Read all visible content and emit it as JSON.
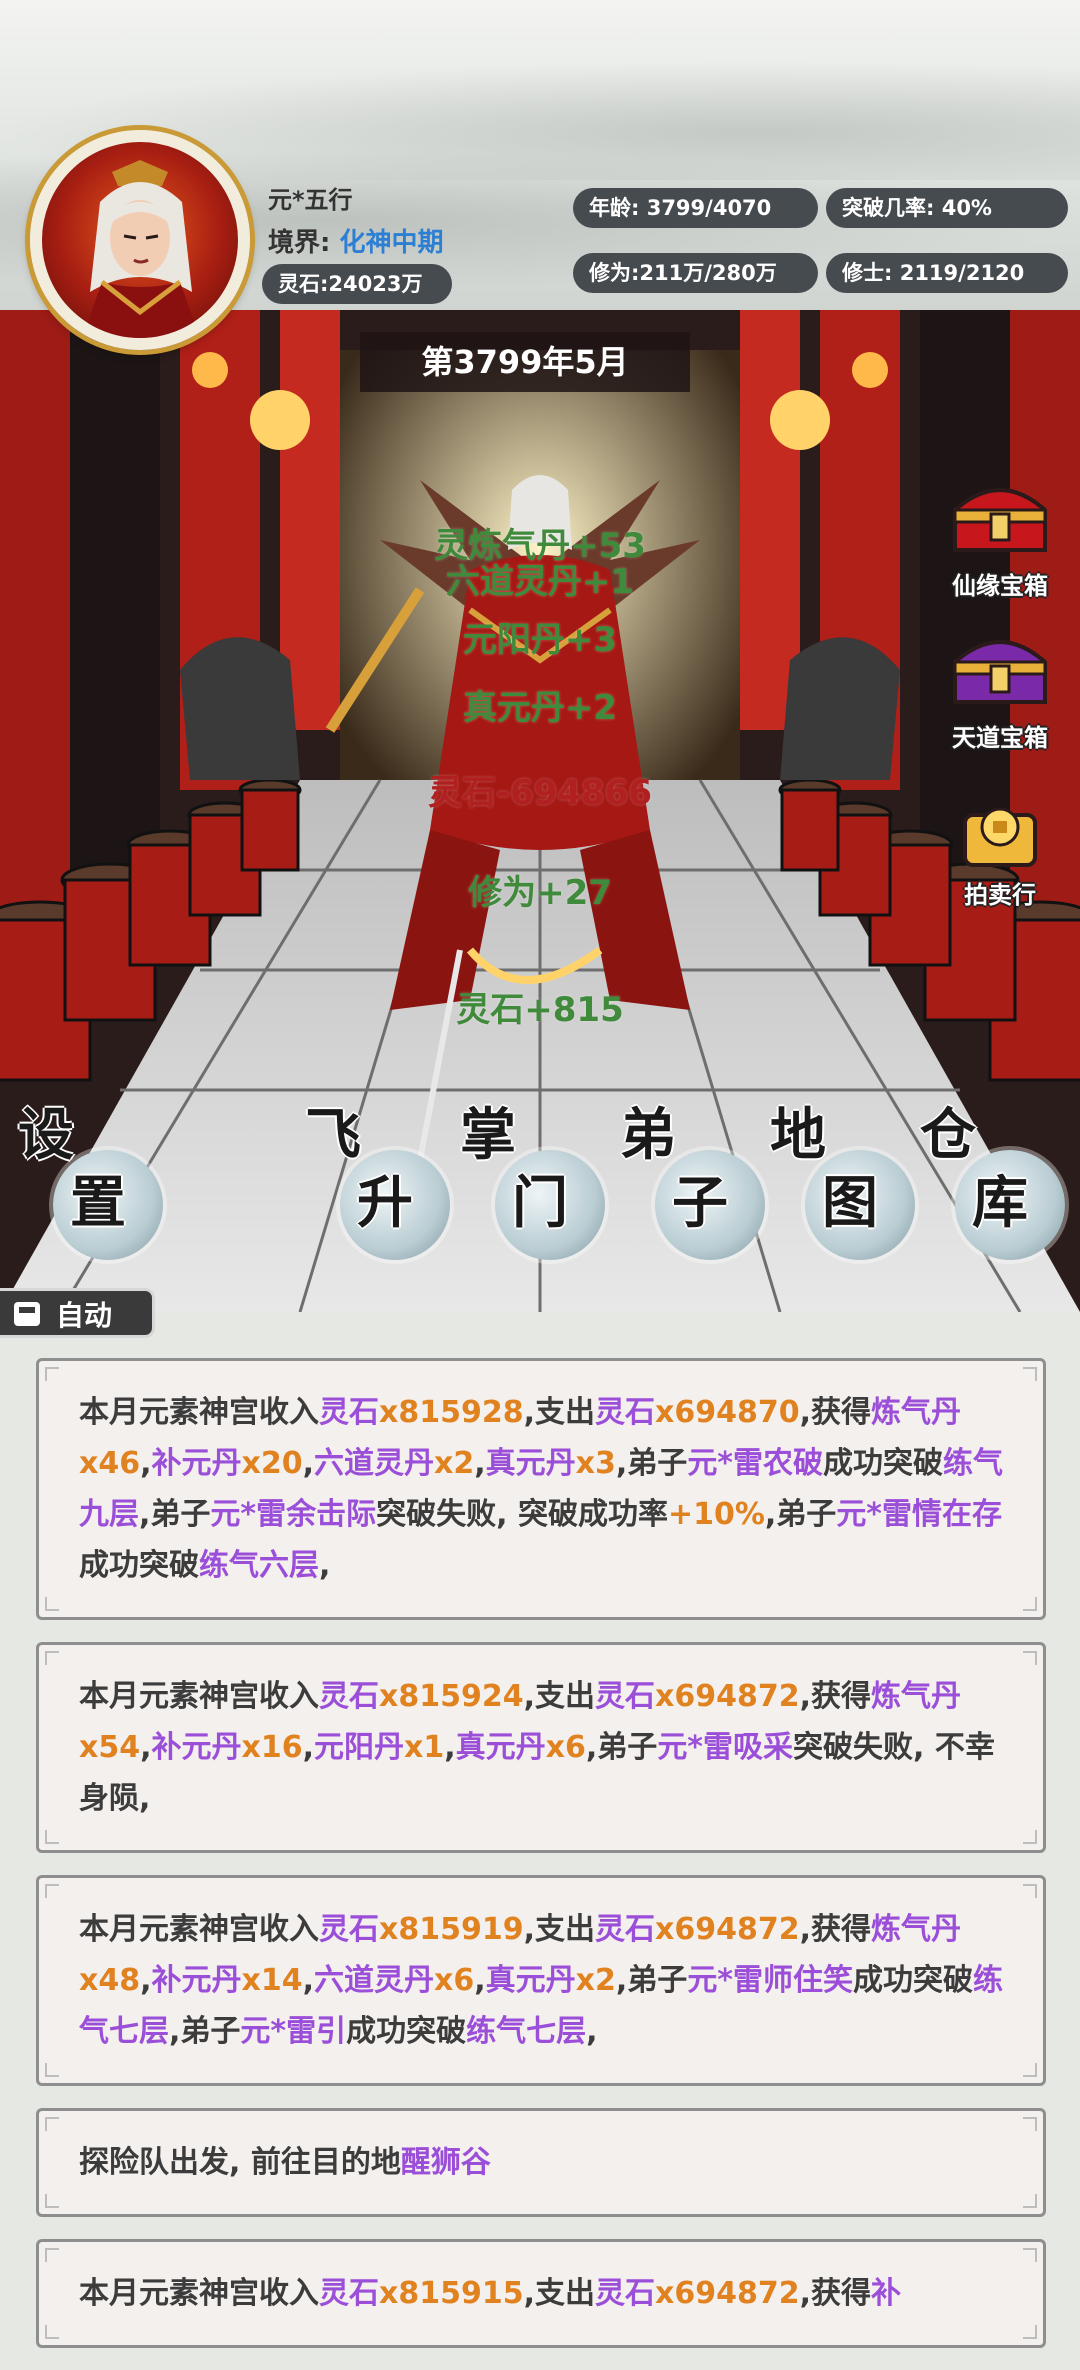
{
  "player": {
    "name": "元*五行",
    "realm_label": "境界:",
    "realm_value": "化神中期",
    "spirit_stone": "灵石:24023万"
  },
  "stats": {
    "age": "年龄: 3799/4070",
    "breakthrough": "突破几率:   40%",
    "cultivation": "修为:211万/280万",
    "disciples": "修士: 2119/2120"
  },
  "scene": {
    "date": "第3799年5月",
    "floating_texts": [
      {
        "text": "灵炼气丹+53",
        "color": "#3f8a3b"
      },
      {
        "text": "六道灵丹+1",
        "color": "#3f8a3b"
      },
      {
        "text": "元阳丹+3",
        "color": "#3f8a3b"
      },
      {
        "text": "真元丹+2",
        "color": "#3f8a3b"
      },
      {
        "text": "灵石-694866",
        "color": "#b02020"
      },
      {
        "text": "修为+27",
        "color": "#3f8a3b"
      },
      {
        "text": "灵石+815",
        "color": "#3f8a3b"
      }
    ]
  },
  "side_buttons": {
    "xianyuan": "仙缘宝箱",
    "tiandao": "天道宝箱",
    "auction": "拍卖行"
  },
  "nav": {
    "settings": [
      "设",
      "置"
    ],
    "ascend": [
      "飞",
      "升"
    ],
    "leader": [
      "掌",
      "门"
    ],
    "disciple": [
      "弟",
      "子"
    ],
    "map": [
      "地",
      "图"
    ],
    "storage": [
      "仓",
      "库"
    ]
  },
  "auto_label": "自动",
  "colors": {
    "purple_item": "#9b4fd9",
    "orange_value": "#e0821f",
    "header_pill": "#464b4f"
  },
  "log_entries": [
    [
      {
        "t": "本月元素神宫收入"
      },
      {
        "t": "灵石",
        "c": "p"
      },
      {
        "t": "x815928",
        "c": "o"
      },
      {
        "t": ",支出"
      },
      {
        "t": "灵石",
        "c": "p"
      },
      {
        "t": "x694870",
        "c": "o"
      },
      {
        "t": ",获得"
      },
      {
        "t": "炼气丹",
        "c": "p"
      },
      {
        "t": "x46",
        "c": "o"
      },
      {
        "t": ","
      },
      {
        "t": "补元丹",
        "c": "p"
      },
      {
        "t": "x20",
        "c": "o"
      },
      {
        "t": ","
      },
      {
        "t": "六道灵丹",
        "c": "p"
      },
      {
        "t": "x2",
        "c": "o"
      },
      {
        "t": ","
      },
      {
        "t": "真元丹",
        "c": "p"
      },
      {
        "t": "x3",
        "c": "o"
      },
      {
        "t": ",弟子"
      },
      {
        "t": "元*雷农破",
        "c": "p"
      },
      {
        "t": "成功突破"
      },
      {
        "t": "练气九层",
        "c": "p"
      },
      {
        "t": ",弟子"
      },
      {
        "t": "元*雷余击际",
        "c": "p"
      },
      {
        "t": "突破失败, 突破成功率"
      },
      {
        "t": "+10%",
        "c": "o"
      },
      {
        "t": ",弟子"
      },
      {
        "t": "元*雷情在存",
        "c": "p"
      },
      {
        "t": "成功突破"
      },
      {
        "t": "练气六层",
        "c": "p"
      },
      {
        "t": ","
      }
    ],
    [
      {
        "t": "本月元素神宫收入"
      },
      {
        "t": "灵石",
        "c": "p"
      },
      {
        "t": "x815924",
        "c": "o"
      },
      {
        "t": ",支出"
      },
      {
        "t": "灵石",
        "c": "p"
      },
      {
        "t": "x694872",
        "c": "o"
      },
      {
        "t": ",获得"
      },
      {
        "t": "炼气丹",
        "c": "p"
      },
      {
        "t": "x54",
        "c": "o"
      },
      {
        "t": ","
      },
      {
        "t": "补元丹",
        "c": "p"
      },
      {
        "t": "x16",
        "c": "o"
      },
      {
        "t": ","
      },
      {
        "t": "元阳丹",
        "c": "p"
      },
      {
        "t": "x1",
        "c": "o"
      },
      {
        "t": ","
      },
      {
        "t": "真元丹",
        "c": "p"
      },
      {
        "t": "x6",
        "c": "o"
      },
      {
        "t": ",弟子"
      },
      {
        "t": "元*雷吸采",
        "c": "p"
      },
      {
        "t": "突破失败, 不幸身陨,"
      }
    ],
    [
      {
        "t": "本月元素神宫收入"
      },
      {
        "t": "灵石",
        "c": "p"
      },
      {
        "t": "x815919",
        "c": "o"
      },
      {
        "t": ",支出"
      },
      {
        "t": "灵石",
        "c": "p"
      },
      {
        "t": "x694872",
        "c": "o"
      },
      {
        "t": ",获得"
      },
      {
        "t": "炼气丹",
        "c": "p"
      },
      {
        "t": "x48",
        "c": "o"
      },
      {
        "t": ","
      },
      {
        "t": "补元丹",
        "c": "p"
      },
      {
        "t": "x14",
        "c": "o"
      },
      {
        "t": ","
      },
      {
        "t": "六道灵丹",
        "c": "p"
      },
      {
        "t": "x6",
        "c": "o"
      },
      {
        "t": ","
      },
      {
        "t": "真元丹",
        "c": "p"
      },
      {
        "t": "x2",
        "c": "o"
      },
      {
        "t": ",弟子"
      },
      {
        "t": "元*雷师住笑",
        "c": "p"
      },
      {
        "t": "成功突破"
      },
      {
        "t": "练气七层",
        "c": "p"
      },
      {
        "t": ",弟子"
      },
      {
        "t": "元*雷引",
        "c": "p"
      },
      {
        "t": "成功突破"
      },
      {
        "t": "练气七层",
        "c": "p"
      },
      {
        "t": ","
      }
    ],
    [
      {
        "t": "探险队出发, 前往目的地"
      },
      {
        "t": "醒狮谷",
        "c": "p"
      }
    ],
    [
      {
        "t": "本月元素神宫收入"
      },
      {
        "t": "灵石",
        "c": "p"
      },
      {
        "t": "x815915",
        "c": "o"
      },
      {
        "t": ",支出"
      },
      {
        "t": "灵石",
        "c": "p"
      },
      {
        "t": "x694872",
        "c": "o"
      },
      {
        "t": ",获得"
      },
      {
        "t": "补",
        "c": "p"
      }
    ]
  ]
}
